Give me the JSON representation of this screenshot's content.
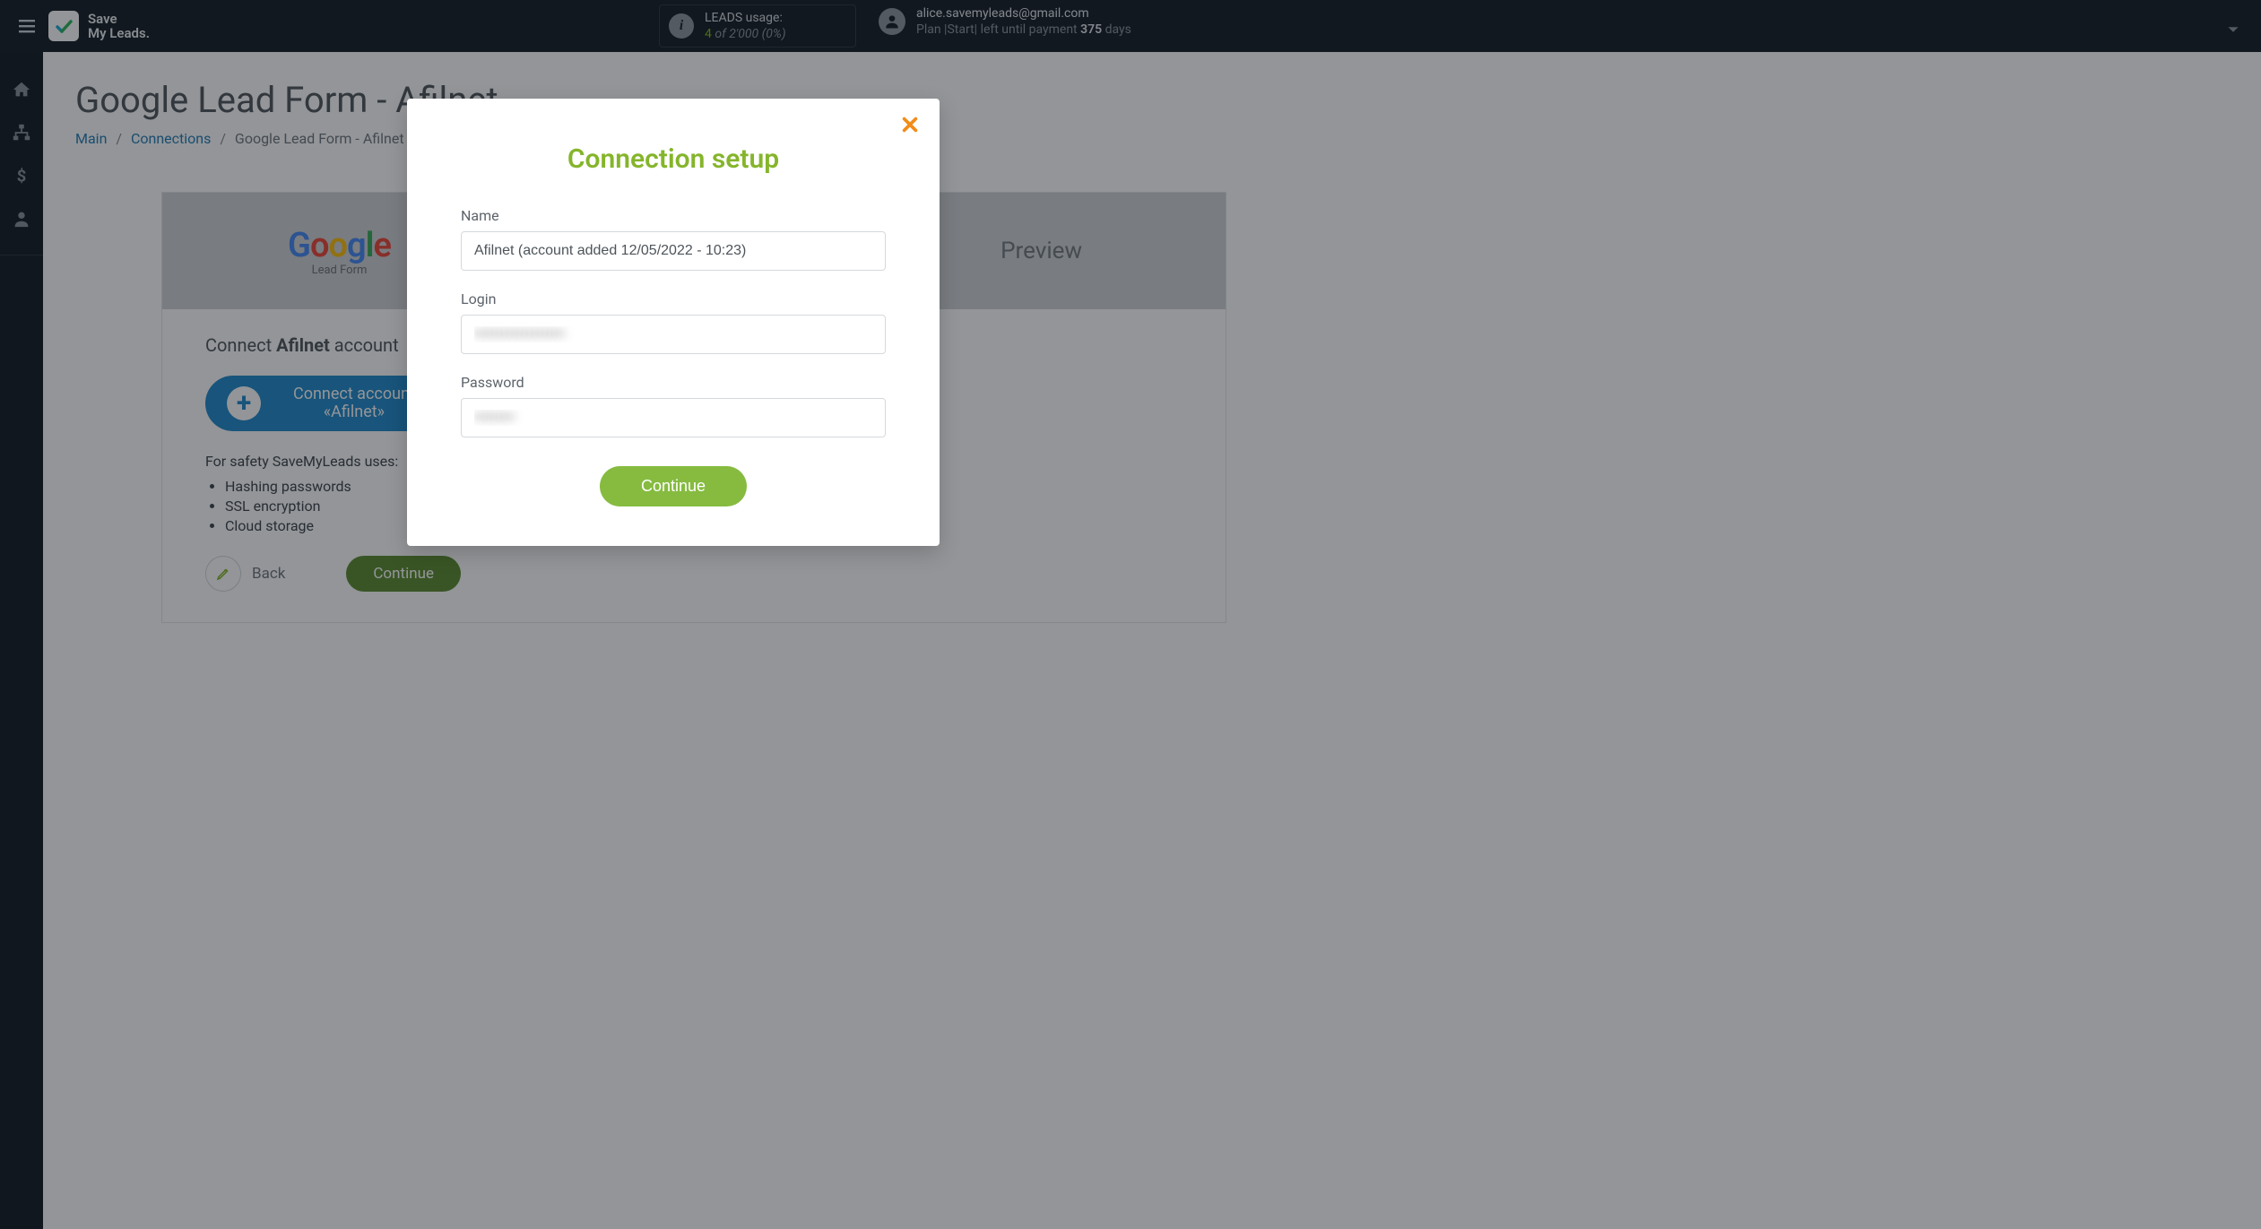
{
  "brand": {
    "line1": "Save",
    "line2": "My Leads."
  },
  "usage": {
    "label": "LEADS usage:",
    "current": "4",
    "of": "of",
    "limit": "2'000",
    "pct": "(0%)"
  },
  "account": {
    "email": "alice.savemyleads@gmail.com",
    "plan_prefix": "Plan |",
    "plan_name": "Start",
    "plan_mid": "| left until payment ",
    "days_n": "375",
    "days_suffix": " days"
  },
  "page": {
    "title": "Google Lead Form - Afilnet"
  },
  "crumbs": {
    "main": "Main",
    "connections": "Connections",
    "current": "Google Lead Form - Afilnet"
  },
  "card": {
    "google_sub": "Lead Form",
    "preview": "Preview",
    "connect_prefix": "Connect ",
    "connect_brand": "Afilnet",
    "connect_suffix": " account",
    "connect_btn_l1": "Connect account",
    "connect_btn_l2": "«Afilnet»",
    "safety_title": "For safety SaveMyLeads uses:",
    "safety_items": [
      "Hashing passwords",
      "SSL encryption",
      "Cloud storage"
    ],
    "back": "Back",
    "continue": "Continue"
  },
  "modal": {
    "title": "Connection setup",
    "name_label": "Name",
    "name_value": "Afilnet (account added 12/05/2022 - 10:23)",
    "login_label": "Login",
    "login_value": "••••••••••••••••••",
    "password_label": "Password",
    "password_value": "••••••••",
    "continue": "Continue"
  }
}
